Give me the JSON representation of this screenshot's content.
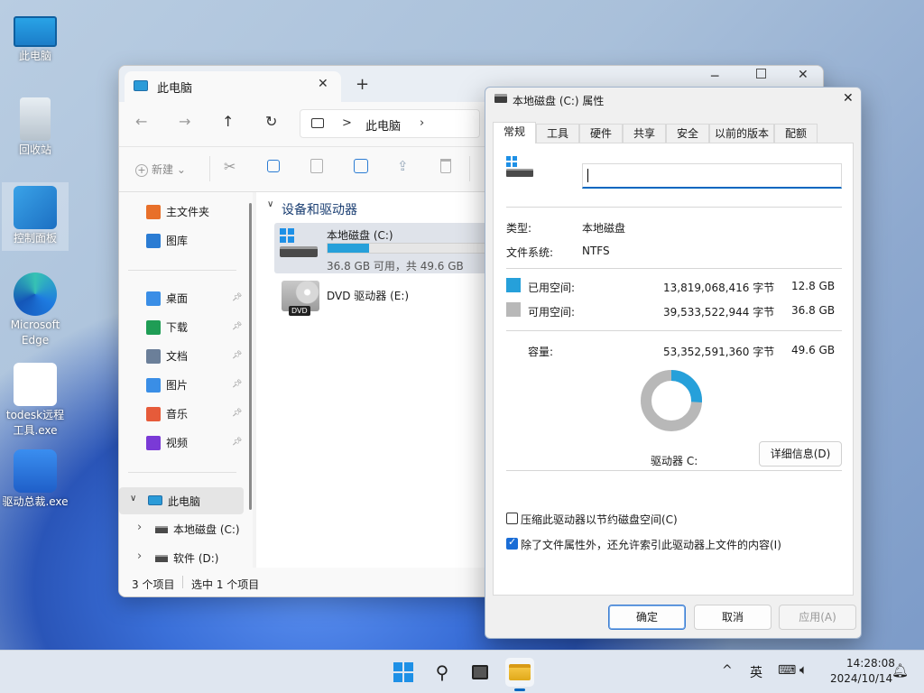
{
  "desktop": {
    "icons": [
      {
        "label": "此电脑",
        "name": "this-pc-icon"
      },
      {
        "label": "回收站",
        "name": "recycle-bin-icon"
      },
      {
        "label": "控制面板",
        "name": "control-panel-icon"
      },
      {
        "label": "Microsoft Edge",
        "name": "edge-icon"
      },
      {
        "label": "todesk远程工具.exe",
        "name": "todesk-icon"
      },
      {
        "label": "驱动总裁.exe",
        "name": "driver-tool-icon"
      }
    ]
  },
  "explorer": {
    "tab_title": "此电脑",
    "new_tab_glyph": "+",
    "address_sep": ">",
    "address": "此电脑",
    "new_button": "新建",
    "sidebar": {
      "quick": [
        {
          "label": "主文件夹",
          "name": "home-icon",
          "color": "#e8702a"
        },
        {
          "label": "图库",
          "name": "gallery-icon",
          "color": "#2b7cd3"
        }
      ],
      "pinned": [
        {
          "label": "桌面",
          "name": "desktop-folder-icon",
          "color": "#3a8ee6"
        },
        {
          "label": "下载",
          "name": "download-icon",
          "color": "#1f9d55"
        },
        {
          "label": "文档",
          "name": "documents-icon",
          "color": "#6b7f99"
        },
        {
          "label": "图片",
          "name": "pictures-icon",
          "color": "#3a8ee6"
        },
        {
          "label": "音乐",
          "name": "music-icon",
          "color": "#e65b3a"
        },
        {
          "label": "视频",
          "name": "videos-icon",
          "color": "#7a3ad6"
        }
      ],
      "this_pc": "此电脑",
      "drives": [
        {
          "label": "本地磁盘 (C:)",
          "name": "drive-c-icon"
        },
        {
          "label": "软件 (D:)",
          "name": "drive-d-icon"
        }
      ]
    },
    "section_title": "设备和驱动器",
    "drives": [
      {
        "name": "本地磁盘 (C:)",
        "info": "36.8 GB 可用，共 49.6 GB",
        "used_fraction": 0.258
      },
      {
        "name": "DVD 驱动器 (E:)",
        "info": "",
        "badge": "DVD"
      }
    ],
    "status": {
      "items": "3 个项目",
      "selected": "选中 1 个项目"
    }
  },
  "dialog": {
    "title": "本地磁盘 (C:) 属性",
    "tabs": [
      "常规",
      "工具",
      "硬件",
      "共享",
      "安全",
      "以前的版本",
      "配额"
    ],
    "active_tab": "常规",
    "name_value": "",
    "type_label": "类型:",
    "type_value": "本地磁盘",
    "fs_label": "文件系统:",
    "fs_value": "NTFS",
    "used_label": "已用空间:",
    "used_bytes": "13,819,068,416 字节",
    "used_gb": "12.8 GB",
    "free_label": "可用空间:",
    "free_bytes": "39,533,522,944 字节",
    "free_gb": "36.8 GB",
    "cap_label": "容量:",
    "cap_bytes": "53,352,591,360 字节",
    "cap_gb": "49.6 GB",
    "used_fraction": 0.259,
    "drive_label": "驱动器 C:",
    "details_button": "详细信息(D)",
    "compress_label": "压缩此驱动器以节约磁盘空间(C)",
    "compress_checked": false,
    "index_label": "除了文件属性外，还允许索引此驱动器上文件的内容(I)",
    "index_checked": true,
    "ok": "确定",
    "cancel": "取消",
    "apply": "应用(A)"
  },
  "colors": {
    "used": "#26a0da",
    "free": "#b8b8b8",
    "accent": "#0067c0"
  },
  "taskbar": {
    "ime": "英",
    "time": "14:28:08",
    "date": "2024/10/14"
  }
}
